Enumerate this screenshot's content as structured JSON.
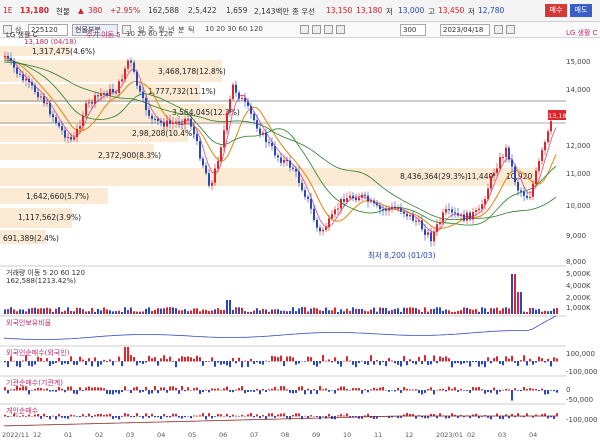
{
  "header": {
    "row1": {
      "code": "1E",
      "price": "13,180",
      "stock_name": "현물",
      "change_arrow": "▲",
      "change": "380",
      "change_pct": "+2.95%",
      "volume": "162,588",
      "value": "2,5,422",
      "ratio": "1,659",
      "vol2": "2,143백만",
      "label_high_low": "종 우선",
      "open": "13,150",
      "high": "13,180",
      "low_label": "저",
      "low": "13,000",
      "diff_label": "고",
      "diff": "13,450",
      "end_label": "저",
      "end": "12,780",
      "btn_buy": "매수",
      "btn_sell": "매도"
    },
    "row2": {
      "menu": "삼",
      "field": "225120",
      "name_btn": "현물부분",
      "period_d": "일",
      "period_w": "주",
      "period_m": "월",
      "period_y": "년",
      "period_min": "분",
      "period_tick": "틱",
      "intervals": "10 20 30 60 120",
      "count": "300",
      "date": "2023/04/18"
    }
  },
  "legend": {
    "title": "LG 생활 C",
    "ma_label": "주가 이동 5",
    "ma_values": "10  20  60  120",
    "price_line": "13,180 (04/18)"
  },
  "right_axis": {
    "labels": [
      "15,000",
      "14,000",
      "13,000",
      "12,000",
      "11,000",
      "10,000",
      "9,000",
      "8,000"
    ],
    "current_price": "13,180",
    "top_badge": "LG 생활 C"
  },
  "box_labels": {
    "b1": "1,317,475(4.6%)",
    "b2": "3,468,178(12.8%)",
    "b3": "1,777,732(11.1%)",
    "b4": "3,564,045(12.3%)",
    "b5": "2,98,208(10.4%)",
    "b6": "2,372,900(8.3%)",
    "b7": "1,642,660(5.7%)",
    "b8": "1,117,562(3.9%)",
    "b9": "691,389(2.4%)",
    "b10": "8,436,364(29.3%)",
    "b11": "11,440",
    "b12": "10,920"
  },
  "annotations": {
    "low_marker": "최저 8,200 (01/03)",
    "high_marker": "13,180 (04/18)"
  },
  "volume_panel": {
    "title": "거래량 이동 5 20 60 120",
    "sub": "162,588(1213.42%)",
    "axis": [
      "5,000K",
      "4,000K",
      "2,000K",
      "1,000K"
    ]
  },
  "panel3": {
    "title": "외국인보유비율",
    "axis": []
  },
  "panel4": {
    "title": "외국인순매수(외국인)",
    "axis": [
      "100,000",
      "0",
      "-100,000"
    ]
  },
  "panel5": {
    "title": "기관순매수(기관계)",
    "axis": [
      "0",
      "-50,000"
    ]
  },
  "panel6": {
    "title": "개인순매수",
    "axis": [
      "0",
      "-100,000"
    ]
  },
  "x_axis": {
    "labels": [
      "2022/11",
      "12",
      "01",
      "02",
      "03",
      "04",
      "05",
      "06",
      "07",
      "08",
      "09",
      "10",
      "11",
      "12",
      "2023/01",
      "02",
      "03",
      "04"
    ]
  },
  "colors": {
    "up": "#e0242c",
    "down": "#2846c8",
    "ma5": "#e05a8a",
    "ma10": "#e38e20",
    "ma20": "#3a8a3a",
    "ma60": "#2a7a2a",
    "box": "#fbe8cc"
  }
}
